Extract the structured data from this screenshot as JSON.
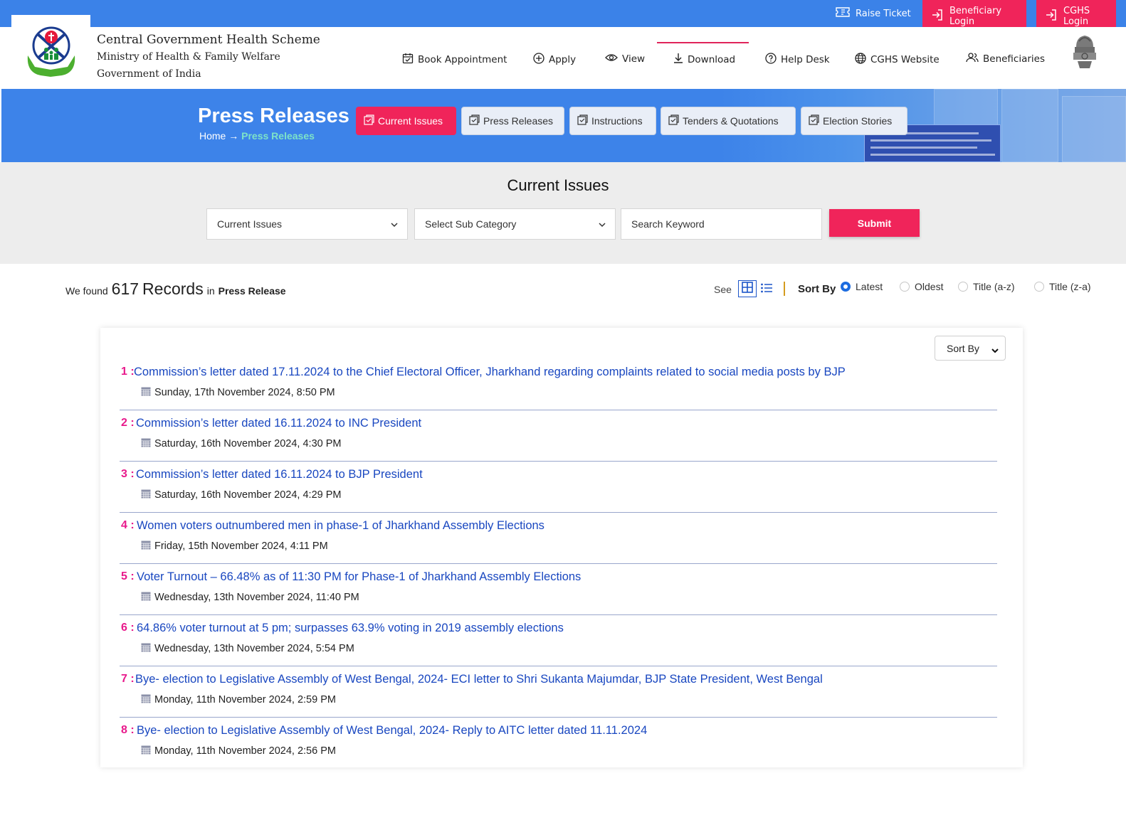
{
  "topbar": {
    "raise_ticket": "Raise Ticket",
    "beneficiary_login": "Beneficiary Login",
    "cghs_login": "CGHS Login"
  },
  "header": {
    "org_name": "Central Government Health Scheme",
    "ministry": "Ministry of Health & Family Welfare",
    "government": "Government of India",
    "nav": [
      {
        "label": "Book Appointment",
        "icon": "calendar-check-icon"
      },
      {
        "label": "Apply",
        "icon": "plus-circle-icon"
      },
      {
        "label": "View",
        "icon": "eye-icon"
      },
      {
        "label": "Download",
        "icon": "download-icon"
      },
      {
        "label": "Help Desk",
        "icon": "question-circle-icon"
      },
      {
        "label": "CGHS Website",
        "icon": "globe-icon"
      },
      {
        "label": "Beneficiaries",
        "icon": "users-icon"
      }
    ]
  },
  "banner": {
    "title": "Press Releases",
    "breadcrumb_home": "Home",
    "breadcrumb_arrow": "→",
    "breadcrumb_current": "Press Releases",
    "tabs": [
      {
        "label": "Current Issues",
        "active": true
      },
      {
        "label": "Press Releases",
        "active": false
      },
      {
        "label": "Instructions",
        "active": false
      },
      {
        "label": "Tenders & Quotations",
        "active": false
      },
      {
        "label": "Election Stories",
        "active": false
      }
    ]
  },
  "filter": {
    "title": "Current Issues",
    "category": "Current Issues",
    "subcategory": "Select Sub Category",
    "search_placeholder": "Search Keyword",
    "submit": "Submit"
  },
  "results": {
    "prefix": "We found",
    "count": "617",
    "records_word": "Records",
    "in_word": "in",
    "section": "Press Release",
    "see": "See",
    "sort_by": "Sort By",
    "sort_options": [
      {
        "label": "Latest",
        "checked": true
      },
      {
        "label": "Oldest",
        "checked": false
      },
      {
        "label": "Title (a-z)",
        "checked": false
      },
      {
        "label": "Title (z-a)",
        "checked": false
      }
    ]
  },
  "list": {
    "sort_select": "Sort By",
    "items": [
      {
        "num": "1 :",
        "title": "Commission’s letter dated 17.11.2024 to the Chief Electoral Officer, Jharkhand regarding complaints related to social media posts by BJP",
        "date": "Sunday, 17th November 2024, 8:50 PM"
      },
      {
        "num": "2 :",
        "title": "Commission’s letter dated 16.11.2024 to INC President",
        "date": "Saturday, 16th November 2024, 4:30 PM"
      },
      {
        "num": "3 :",
        "title": "Commission’s letter dated 16.11.2024 to BJP President",
        "date": "Saturday, 16th November 2024, 4:29 PM"
      },
      {
        "num": "4 :",
        "title": "Women voters outnumbered men in phase-1 of Jharkhand Assembly Elections",
        "date": "Friday, 15th November 2024, 4:11 PM"
      },
      {
        "num": "5 :",
        "title": "Voter Turnout – 66.48% as of 11:30 PM for Phase-1 of Jharkhand Assembly Elections",
        "date": "Wednesday, 13th November 2024, 11:40 PM"
      },
      {
        "num": "6 :",
        "title": "64.86% voter turnout at 5 pm; surpasses 63.9% voting in 2019 assembly elections",
        "date": "Wednesday, 13th November 2024, 5:54 PM"
      },
      {
        "num": "7 :",
        "title": "Bye- election to Legislative Assembly of West Bengal, 2024- ECI letter to Shri Sukanta Majumdar, BJP State President, West Bengal",
        "date": "Monday, 11th November 2024, 2:59 PM"
      },
      {
        "num": "8 :",
        "title": "Bye- election to Legislative Assembly of West Bengal, 2024- Reply to AITC letter dated 11.11.2024",
        "date": "Monday, 11th November 2024, 2:56 PM"
      }
    ]
  },
  "colors": {
    "topbar": "#3b82e8",
    "accent": "#f0245a",
    "link": "#1947c0",
    "number": "#e8198b"
  }
}
